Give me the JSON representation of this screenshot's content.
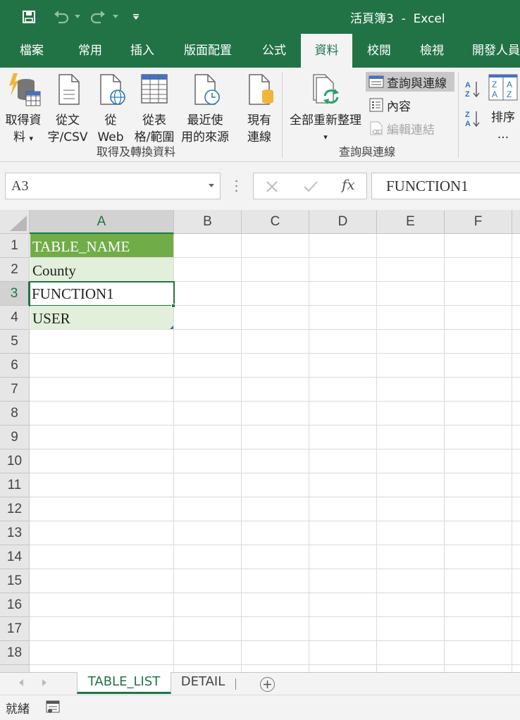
{
  "title_bar": {
    "title": "活頁簿3  -  Excel",
    "quick_access": [
      "save-icon",
      "undo-icon",
      "redo-icon",
      "customize-qat-icon"
    ]
  },
  "ribbon_tabs": [
    {
      "label": "檔案",
      "active": false
    },
    {
      "label": "常用",
      "active": false
    },
    {
      "label": "插入",
      "active": false
    },
    {
      "label": "版面配置",
      "active": false
    },
    {
      "label": "公式",
      "active": false
    },
    {
      "label": "資料",
      "active": true
    },
    {
      "label": "校閱",
      "active": false
    },
    {
      "label": "檢視",
      "active": false
    },
    {
      "label": "開發人員",
      "active": false
    }
  ],
  "ribbon": {
    "get_transform": {
      "get_data": [
        "取得資",
        "料"
      ],
      "from_text": [
        "從文",
        "字/CSV"
      ],
      "from_web": [
        "從",
        "Web"
      ],
      "from_table": [
        "從表",
        "格/範圍"
      ],
      "recent_sources": [
        "最近使",
        "用的來源"
      ],
      "existing": [
        "現有",
        "連線"
      ],
      "group_label": "取得及轉換資料"
    },
    "queries": {
      "refresh_all": [
        "全部重新整理"
      ],
      "queries_connections": "查詢與連線",
      "properties": "內容",
      "edit_links": "編輯連結",
      "group_label": "查詢與連線"
    },
    "sort": {
      "sort_label": [
        "排序",
        "..."
      ]
    }
  },
  "formula_bar": {
    "name_box": "A3",
    "fx": "fx",
    "formula": "FUNCTION1"
  },
  "grid": {
    "columns": [
      "A",
      "B",
      "C",
      "D",
      "E",
      "F"
    ],
    "rows": [
      "1",
      "2",
      "3",
      "4",
      "5",
      "6",
      "7",
      "8",
      "9",
      "10",
      "11",
      "12",
      "13",
      "14",
      "15",
      "16",
      "17",
      "18"
    ],
    "selected_column": "A",
    "selected_row": "3",
    "cells": {
      "A1": "TABLE_NAME",
      "A2": "County",
      "A3": "FUNCTION1",
      "A4": "USER"
    },
    "colors": {
      "table_header": "#70ad47",
      "table_band": "#e2efda",
      "accent": "#217346"
    }
  },
  "sheet_tabs": [
    {
      "label": "TABLE_LIST",
      "active": true
    },
    {
      "label": "DETAIL",
      "active": false
    }
  ],
  "status_bar": {
    "status": "就緒"
  }
}
